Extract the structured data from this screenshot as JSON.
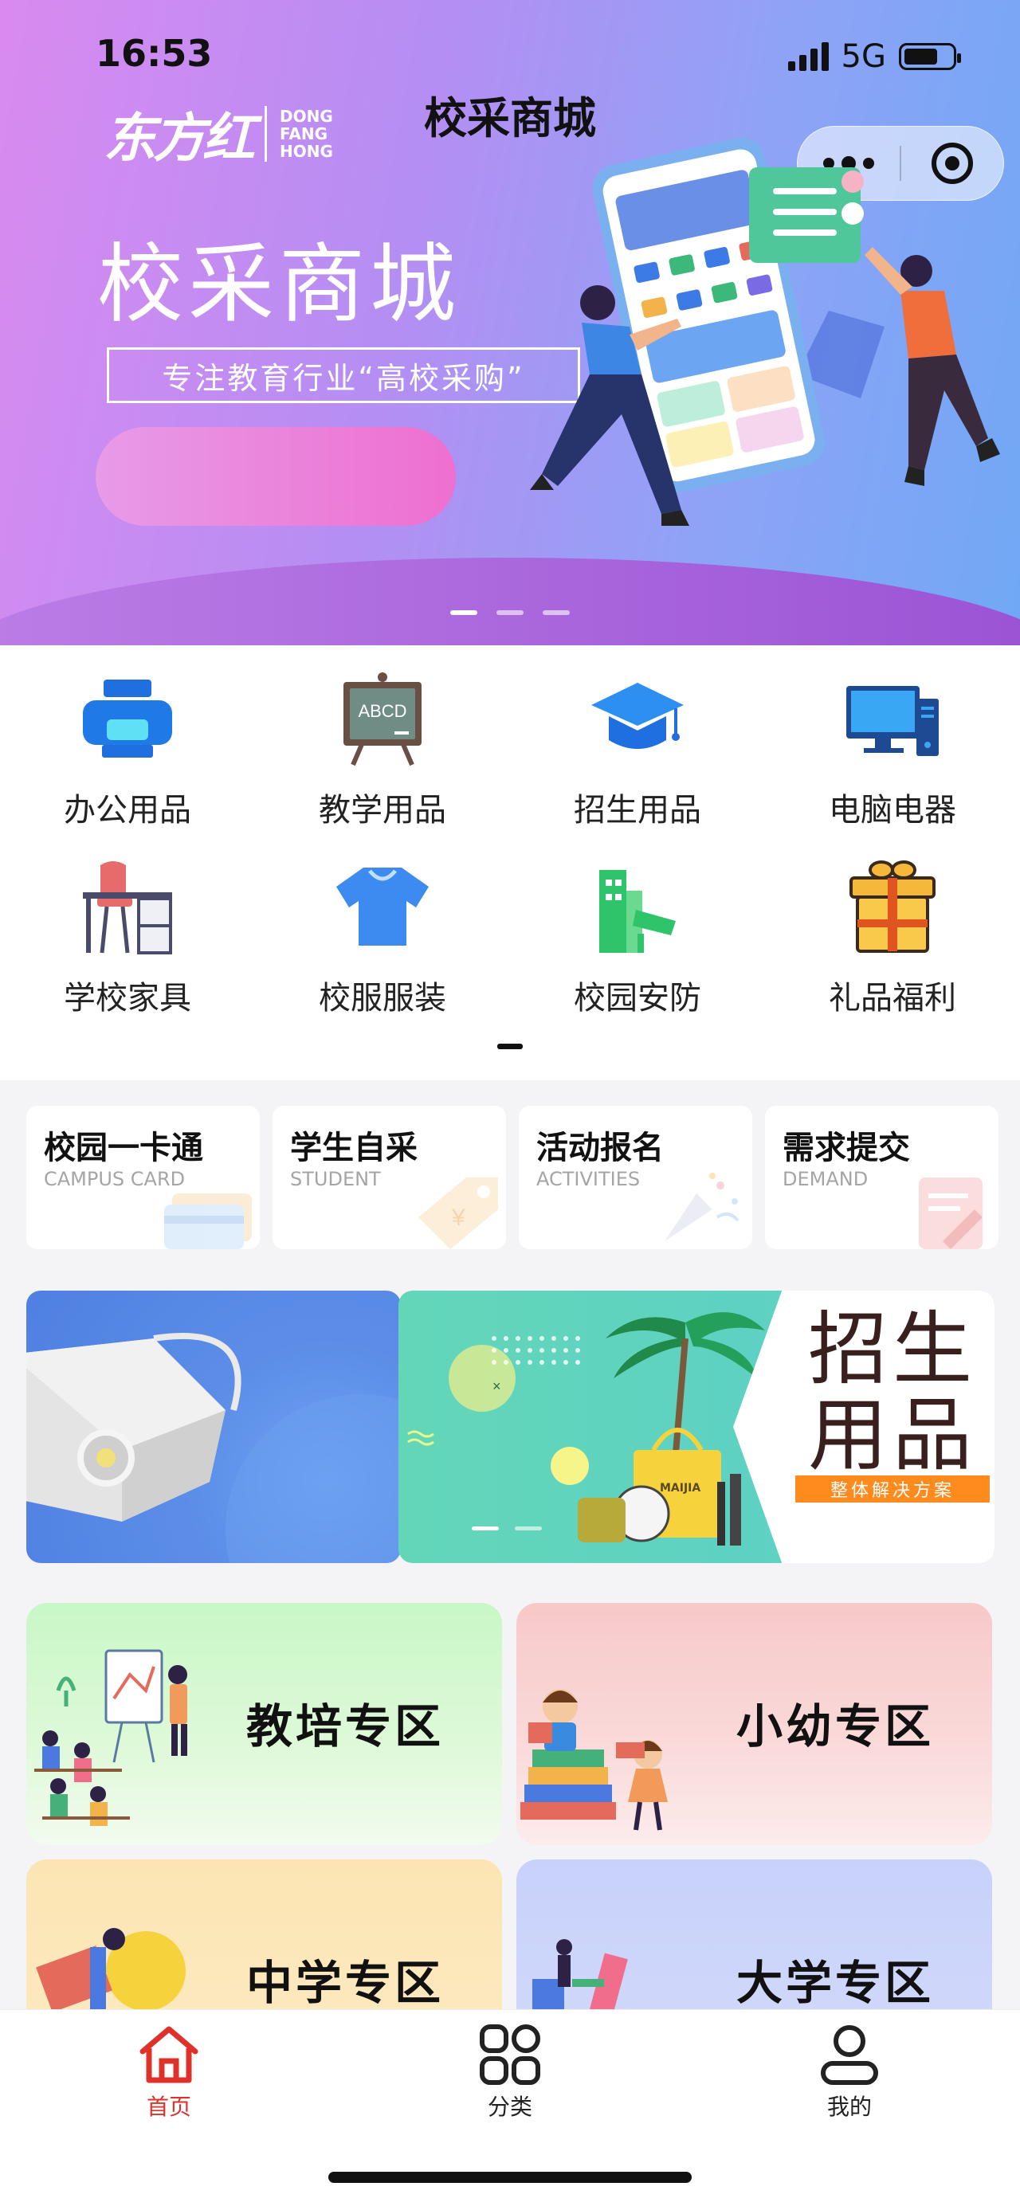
{
  "status_bar": {
    "time": "16:53",
    "network": "5G"
  },
  "brand": {
    "script": "东方红",
    "en_line1": "DONG",
    "en_line2": "FANG",
    "en_line3": "HONG"
  },
  "nav": {
    "title": "校采商城"
  },
  "hero": {
    "headline": "校采商城",
    "subtitle": "专注教育行业“高校采购”",
    "slide_count": 3,
    "active_slide": 1
  },
  "categories": [
    {
      "label": "办公用品",
      "icon": "printer-icon"
    },
    {
      "label": "教学用品",
      "icon": "blackboard-icon"
    },
    {
      "label": "招生用品",
      "icon": "graduation-cap-icon"
    },
    {
      "label": "电脑电器",
      "icon": "computer-icon"
    },
    {
      "label": "学校家具",
      "icon": "desk-icon"
    },
    {
      "label": "校服服装",
      "icon": "tshirt-icon"
    },
    {
      "label": "校园安防",
      "icon": "security-camera-icon"
    },
    {
      "label": "礼品福利",
      "icon": "gift-icon"
    }
  ],
  "quick_links": [
    {
      "title": "校园一卡通",
      "subtitle": "CAMPUS CARD"
    },
    {
      "title": "学生自采",
      "subtitle": "STUDENT"
    },
    {
      "title": "活动报名",
      "subtitle": "ACTIVITIES"
    },
    {
      "title": "需求提交",
      "subtitle": "DEMAND"
    }
  ],
  "promo_banner": {
    "title_line1": "招生",
    "title_line2": "用品",
    "tagline": "整体解决方案",
    "bag_brand": "MAIJIA",
    "slide_count": 2,
    "active_slide": 1
  },
  "zones": [
    {
      "label": "教培专区"
    },
    {
      "label": "小幼专区"
    },
    {
      "label": "中学专区"
    },
    {
      "label": "大学专区"
    }
  ],
  "tabbar": {
    "items": [
      {
        "label": "首页",
        "icon": "home-icon",
        "active": true
      },
      {
        "label": "分类",
        "icon": "grid-icon",
        "active": false
      },
      {
        "label": "我的",
        "icon": "user-icon",
        "active": false
      }
    ]
  },
  "colors": {
    "accent_red": "#e0302a",
    "hero_start": "#d98af0",
    "hero_end": "#70a8f5"
  }
}
